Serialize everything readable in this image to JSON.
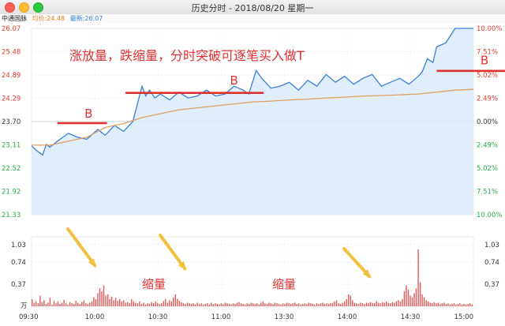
{
  "window": {
    "title": "历史分时 - 2018/08/20 星期一"
  },
  "legend": {
    "stock_name": "中通国脉",
    "avg_label": "均价:24.48",
    "last_label": "最新:26.07"
  },
  "annotations": {
    "headline": "涨放量，跌缩量，分时突破可逐笔买入做T",
    "buy_marker": "B",
    "shrink_label": "缩量"
  },
  "chart_data": {
    "type": "line",
    "price_axis": {
      "ticks": [
        "26.07",
        "25.48",
        "24.89",
        "24.29",
        "23.70",
        "23.11",
        "22.52",
        "21.92",
        "21.33"
      ],
      "ylim": [
        21.33,
        26.07
      ]
    },
    "percent_axis": {
      "ticks": [
        "10.00%",
        "7.51%",
        "5.02%",
        "2.49%",
        "0.00%",
        "2.49%",
        "5.02%",
        "7.51%",
        "10.00%"
      ]
    },
    "volume_axis": {
      "ticks": [
        "1.03",
        "0.74",
        "0.37"
      ],
      "unit": "万"
    },
    "x_ticks": [
      "09:30",
      "10:00",
      "10:30",
      "11:00",
      "13:30",
      "14:00",
      "14:30",
      "15:00"
    ],
    "series": [
      {
        "x": [
          0,
          3,
          6,
          8,
          10,
          14,
          20,
          25,
          30,
          36,
          40,
          45,
          50,
          55,
          60,
          62,
          64,
          67,
          70,
          75,
          80,
          85,
          90,
          95,
          100,
          105,
          110,
          115,
          118,
          122,
          125,
          130,
          135,
          140,
          145,
          150,
          155,
          160,
          165,
          170,
          175,
          180,
          185,
          190,
          195,
          200,
          205,
          210,
          212,
          215,
          218,
          220,
          225,
          230,
          235,
          240
        ],
        "values": [
          23.08,
          22.95,
          22.85,
          23.12,
          23.05,
          23.2,
          23.4,
          23.3,
          23.25,
          23.5,
          23.35,
          23.6,
          23.45,
          23.7,
          24.6,
          24.35,
          24.5,
          24.3,
          24.4,
          24.25,
          24.45,
          24.3,
          24.35,
          24.5,
          24.35,
          24.4,
          24.6,
          24.5,
          24.4,
          25.0,
          24.8,
          24.55,
          24.6,
          24.7,
          24.5,
          24.75,
          24.6,
          24.9,
          24.7,
          24.85,
          24.65,
          24.8,
          24.9,
          24.6,
          24.7,
          24.8,
          24.65,
          24.85,
          24.95,
          25.3,
          25.2,
          25.6,
          25.7,
          26.07,
          26.07,
          26.07
        ]
      },
      {
        "x": [
          0,
          10,
          20,
          30,
          40,
          50,
          60,
          70,
          80,
          90,
          100,
          110,
          120,
          130,
          140,
          150,
          160,
          170,
          180,
          190,
          200,
          210,
          220,
          230,
          240
        ],
        "values": [
          23.1,
          23.1,
          23.2,
          23.3,
          23.55,
          23.65,
          23.8,
          23.9,
          24.0,
          24.05,
          24.1,
          24.15,
          24.2,
          24.22,
          24.25,
          24.27,
          24.3,
          24.32,
          24.35,
          24.36,
          24.38,
          24.4,
          24.45,
          24.5,
          24.52
        ]
      },
      {
        "values": [
          0.12,
          0.06,
          0.08,
          0.05,
          0.18,
          0.07,
          0.1,
          0.04,
          0.06,
          0.14,
          0.03,
          0.09,
          0.05,
          0.08,
          0.04,
          0.06,
          0.11,
          0.05,
          0.03,
          0.07,
          0.05,
          0.04,
          0.09,
          0.06,
          0.04,
          0.07,
          0.1,
          0.05,
          0.04,
          0.06,
          0.08,
          0.15,
          0.12,
          0.22,
          0.3,
          0.25,
          0.35,
          0.18,
          0.2,
          0.12,
          0.16,
          0.1,
          0.14,
          0.09,
          0.12,
          0.08,
          0.1,
          0.06,
          0.07,
          0.05,
          0.12,
          0.08,
          0.06,
          0.05,
          0.08,
          0.04,
          0.06,
          0.03,
          0.05,
          0.04,
          0.07,
          0.05,
          0.08,
          0.06,
          0.04,
          0.05,
          0.09,
          0.12,
          0.06,
          0.1,
          0.08,
          0.15,
          0.2,
          0.12,
          0.09,
          0.07,
          0.05,
          0.04,
          0.06,
          0.05,
          0.04,
          0.05,
          0.03,
          0.06,
          0.04,
          0.05,
          0.03,
          0.04,
          0.05,
          0.03,
          0.06,
          0.04,
          0.05,
          0.04,
          0.03,
          0.05,
          0.04,
          0.06,
          0.05,
          0.04,
          0.03,
          0.05,
          0.04,
          0.06,
          0.07,
          0.05,
          0.04,
          0.03,
          0.05,
          0.04,
          0.06,
          0.05,
          0.04,
          0.05,
          0.03,
          0.06,
          0.08,
          0.05,
          0.04,
          0.06,
          0.05,
          0.04,
          0.06,
          0.05,
          0.04,
          0.03,
          0.05,
          0.04,
          0.06,
          0.05,
          0.04,
          0.05,
          0.06,
          0.04,
          0.05,
          0.03,
          0.04,
          0.05,
          0.04,
          0.06,
          0.05,
          0.04,
          0.03,
          0.05,
          0.04,
          0.05,
          0.06,
          0.04,
          0.05,
          0.04,
          0.05,
          0.06,
          0.08,
          0.1,
          0.05,
          0.04,
          0.06,
          0.08,
          0.12,
          0.2,
          0.18,
          0.1,
          0.06,
          0.05,
          0.04,
          0.06,
          0.05,
          0.04,
          0.06,
          0.05,
          0.07,
          0.06,
          0.05,
          0.08,
          0.06,
          0.05,
          0.07,
          0.06,
          0.08,
          0.06,
          0.05,
          0.07,
          0.06,
          0.08,
          0.1,
          0.08,
          0.12,
          0.25,
          0.35,
          0.28,
          0.18,
          0.15,
          0.22,
          0.3,
          0.95,
          0.4,
          0.2,
          0.15,
          0.1,
          0.08,
          0.06,
          0.05,
          0.07,
          0.05,
          0.06,
          0.04,
          0.05,
          0.06,
          0.04,
          0.05,
          0.03,
          0.04,
          0.05,
          0.03,
          0.04,
          0.05,
          0.03,
          0.04,
          0.03,
          0.04,
          0.05,
          0.03
        ]
      }
    ],
    "colors": {
      "price_line": "#3a7fd5",
      "price_fill": "#dbeaf9",
      "avg_line": "#e0a060",
      "up_text": "#e23a2e",
      "down_text": "#2aa84a",
      "volume": "#e05a5a",
      "annotation": "#e03030",
      "arrow": "#f0c040"
    }
  }
}
